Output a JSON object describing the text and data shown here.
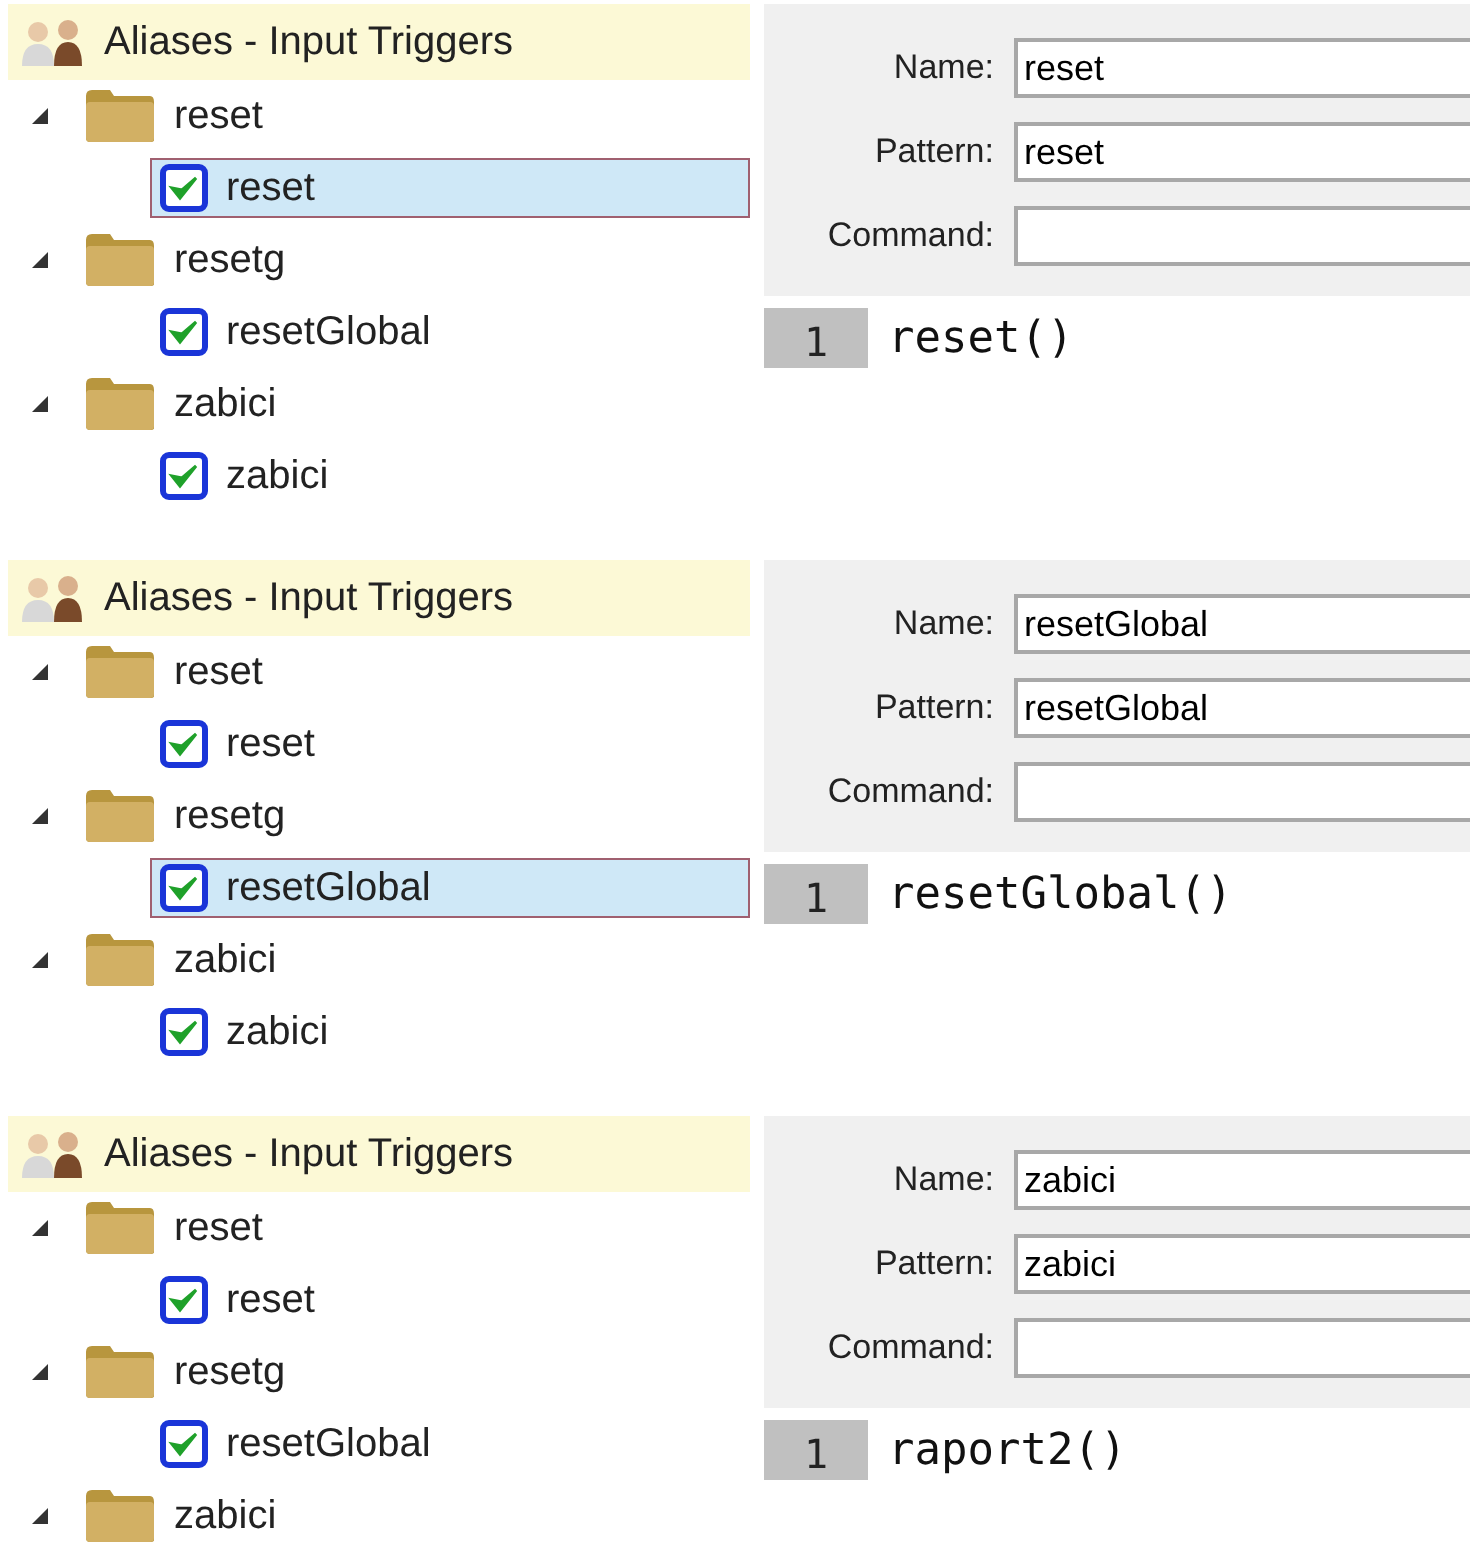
{
  "panels": [
    {
      "tree": {
        "title": "Aliases - Input Triggers",
        "items": [
          {
            "label": "reset",
            "expanded": true,
            "children": [
              {
                "label": "reset",
                "checked": true,
                "selected": true
              }
            ]
          },
          {
            "label": "resetg",
            "expanded": true,
            "children": [
              {
                "label": "resetGlobal",
                "checked": true,
                "selected": false
              }
            ]
          },
          {
            "label": "zabici",
            "expanded": true,
            "children": [
              {
                "label": "zabici",
                "checked": true,
                "selected": false
              }
            ]
          }
        ]
      },
      "form": {
        "fields": [
          {
            "label": "Name:",
            "value": "reset"
          },
          {
            "label": "Pattern:",
            "value": "reset"
          },
          {
            "label": "Command:"
          }
        ],
        "editor": {
          "lines": [
            {
              "number": "1",
              "code": "reset()"
            }
          ]
        }
      }
    },
    {
      "tree": {
        "title": "Aliases - Input Triggers",
        "items": [
          {
            "label": "reset",
            "expanded": true,
            "children": [
              {
                "label": "reset",
                "checked": true,
                "selected": false
              }
            ]
          },
          {
            "label": "resetg",
            "expanded": true,
            "children": [
              {
                "label": "resetGlobal",
                "checked": true,
                "selected": true
              }
            ]
          },
          {
            "label": "zabici",
            "expanded": true,
            "children": [
              {
                "label": "zabici",
                "checked": true,
                "selected": false
              }
            ]
          }
        ]
      },
      "form": {
        "fields": [
          {
            "label": "Name:",
            "value": "resetGlobal"
          },
          {
            "label": "Pattern:",
            "value": "resetGlobal"
          },
          {
            "label": "Command:"
          }
        ],
        "editor": {
          "lines": [
            {
              "number": "1",
              "code": "resetGlobal()"
            }
          ]
        }
      }
    },
    {
      "tree": {
        "title": "Aliases - Input Triggers",
        "items": [
          {
            "label": "reset",
            "expanded": true,
            "children": [
              {
                "label": "reset",
                "checked": true,
                "selected": false
              }
            ]
          },
          {
            "label": "resetg",
            "expanded": true,
            "children": [
              {
                "label": "resetGlobal",
                "checked": true,
                "selected": false
              }
            ]
          },
          {
            "label": "zabici",
            "expanded": true
          }
        ]
      },
      "form": {
        "fields": [
          {
            "label": "Name:",
            "value": "zabici"
          },
          {
            "label": "Pattern:",
            "value": "zabici"
          },
          {
            "label": "Command:"
          }
        ],
        "editor": {
          "lines": [
            {
              "number": "1",
              "code": "raport2()"
            }
          ]
        }
      }
    }
  ]
}
